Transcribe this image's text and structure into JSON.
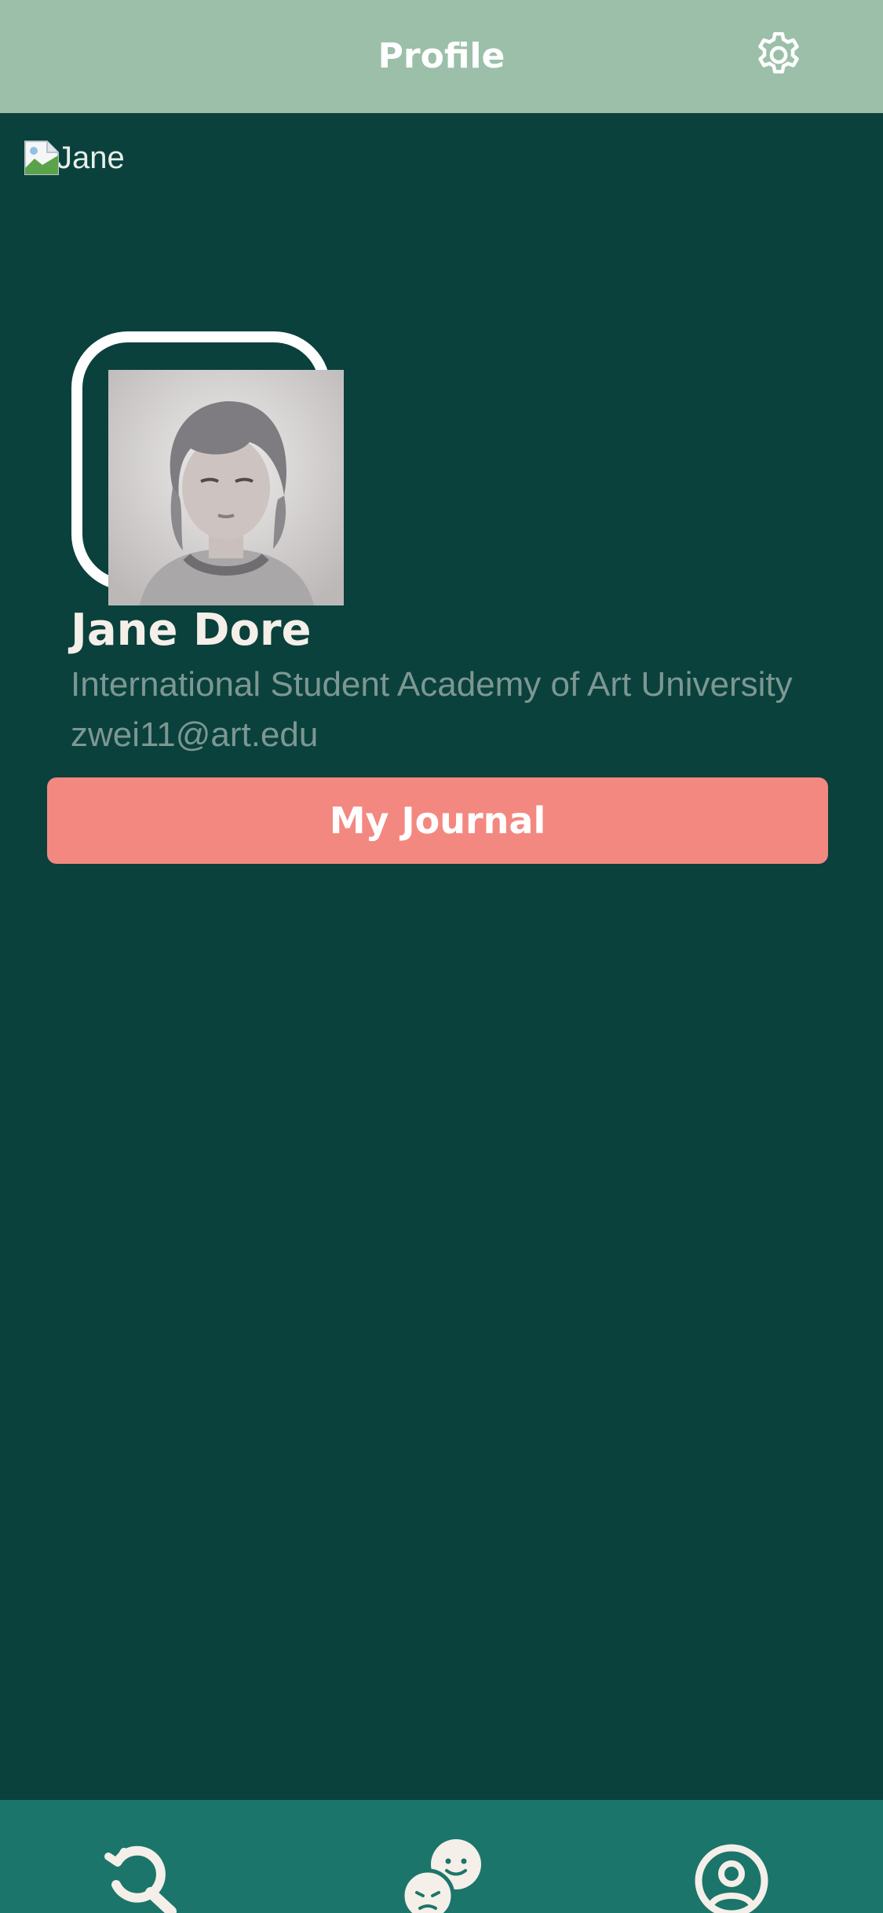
{
  "header": {
    "title": "Profile",
    "settings_icon": "gear-icon"
  },
  "broken_image": {
    "alt": "Jane"
  },
  "profile": {
    "name": "Jane Dore",
    "description": "International Student Academy of Art University zwei11@art.edu"
  },
  "actions": {
    "journal_label": "My Journal"
  },
  "bottom_nav": {
    "items": [
      {
        "icon": "search-history-icon"
      },
      {
        "icon": "mood-chat-icon"
      },
      {
        "icon": "user-profile-icon"
      }
    ]
  },
  "colors": {
    "background": "#0a413c",
    "header": "#9bbfa9",
    "accent_button": "#f38880",
    "bottom_nav": "#1b756a",
    "name_text": "#f4efe8",
    "muted_text": "#7d9792"
  }
}
